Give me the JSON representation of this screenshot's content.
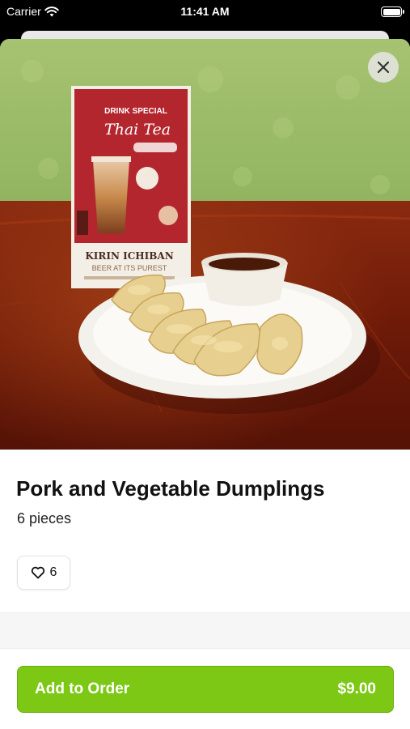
{
  "status_bar": {
    "carrier": "Carrier",
    "time": "11:41 AM",
    "wifi_icon": "wifi-icon",
    "battery_icon": "battery-icon"
  },
  "item": {
    "name": "Pork and Vegetable Dumplings",
    "description": "6 pieces",
    "likes": "6",
    "image_signage": {
      "line1": "DRINK SPECIAL",
      "line2": "Thai Tea",
      "line3": "KIRIN ICHIBAN",
      "line4": "BEER AT ITS PUREST"
    }
  },
  "actions": {
    "close_icon": "close-icon",
    "like_icon": "heart-icon",
    "add_label": "Add to Order",
    "price": "$9.00"
  },
  "colors": {
    "accent": "#7cc814",
    "wall": "#9fbf6a",
    "table": "#7a1c0c"
  }
}
